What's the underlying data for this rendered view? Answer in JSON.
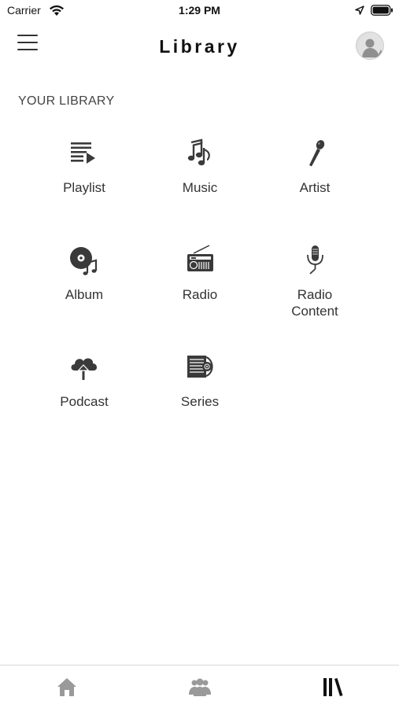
{
  "status_bar": {
    "carrier": "Carrier",
    "time": "1:29 PM"
  },
  "header": {
    "title": "Library",
    "menu_icon": "hamburger-menu-icon",
    "avatar_icon": "user-avatar"
  },
  "section": {
    "title": "YOUR LIBRARY"
  },
  "library_items": [
    {
      "label": "Playlist",
      "icon": "playlist-icon"
    },
    {
      "label": "Music",
      "icon": "music-notes-icon"
    },
    {
      "label": "Artist",
      "icon": "microphone-icon"
    },
    {
      "label": "Album",
      "icon": "album-icon"
    },
    {
      "label": "Radio",
      "icon": "radio-icon"
    },
    {
      "label": "Radio\nContent",
      "icon": "studio-microphone-icon"
    },
    {
      "label": "Podcast",
      "icon": "podcast-cloud-icon"
    },
    {
      "label": "Series",
      "icon": "series-icon"
    }
  ],
  "tab_bar": {
    "tabs": [
      {
        "name": "home",
        "icon": "home-icon",
        "active": false
      },
      {
        "name": "community",
        "icon": "people-icon",
        "active": false
      },
      {
        "name": "library",
        "icon": "library-icon",
        "active": true
      }
    ]
  },
  "colors": {
    "icon": "#3a3a3a",
    "inactive_tab": "#9a9a9a",
    "active_tab": "#111111"
  }
}
